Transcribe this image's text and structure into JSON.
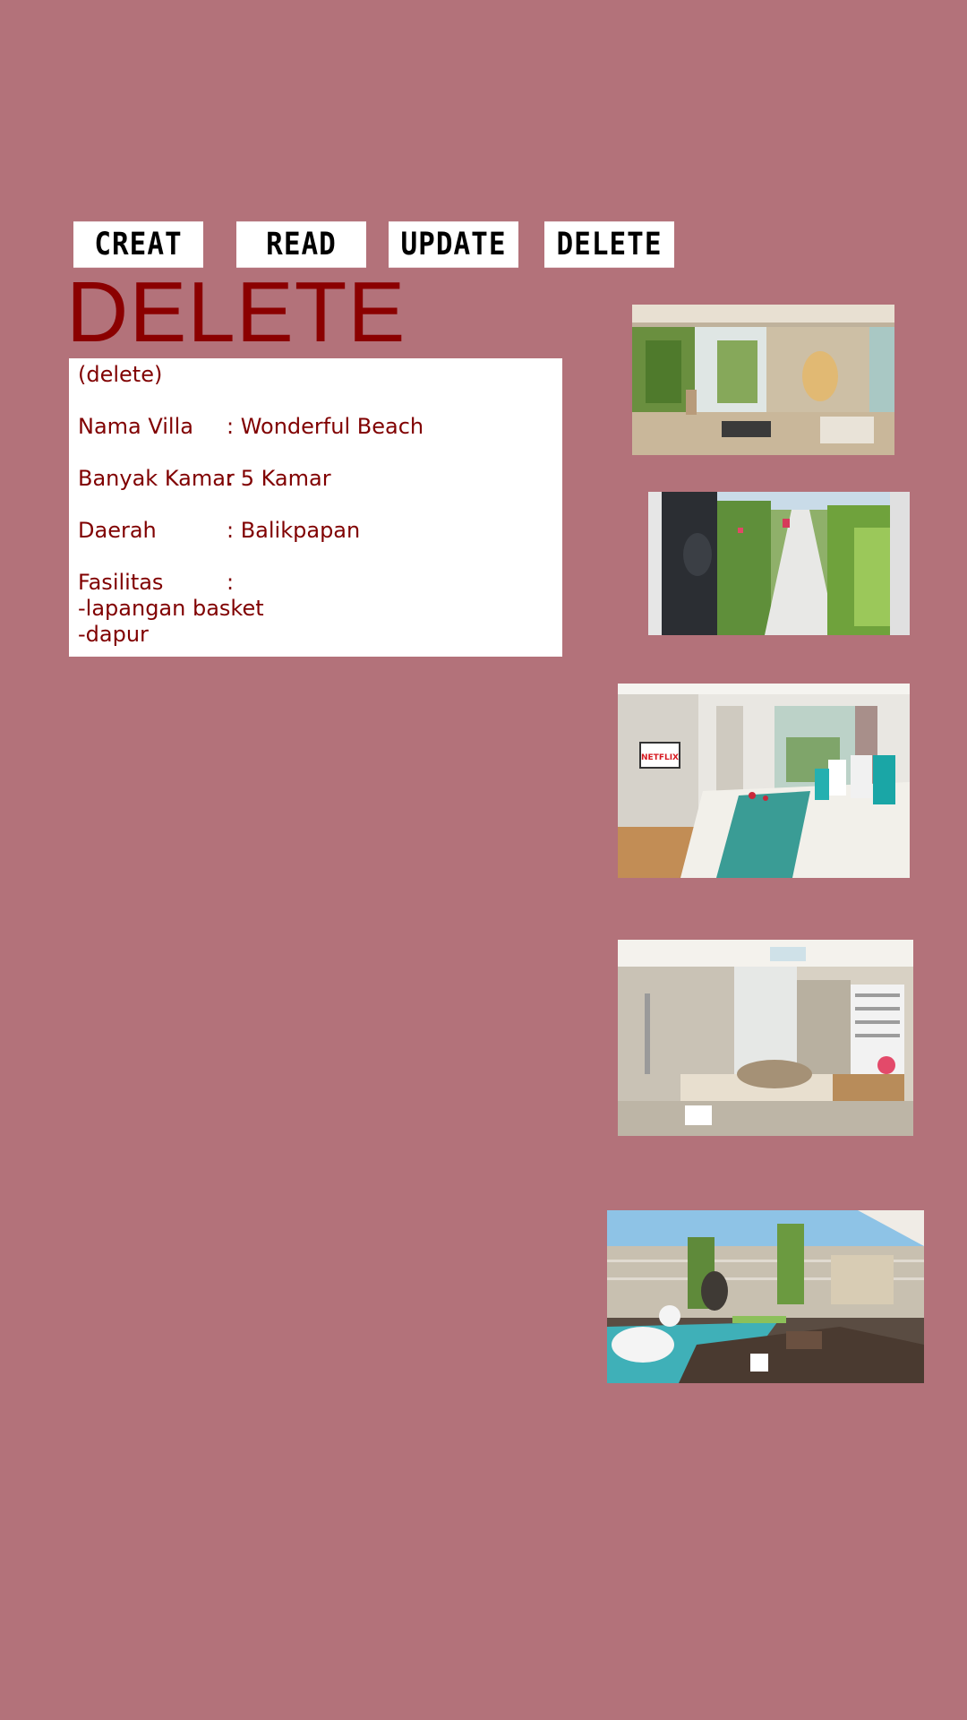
{
  "nav": {
    "create_label": "CREAT",
    "read_label": "READ",
    "update_label": "UPDATE",
    "delete_label": "DELETE"
  },
  "page_title": "DELETE",
  "card": {
    "mode": "(delete)",
    "fields": [
      {
        "label": "Nama Villa",
        "value": ": Wonderful Beach"
      },
      {
        "label": "Banyak Kamar",
        "value": ": 5 Kamar"
      },
      {
        "label": "Daerah",
        "value": ": Balikpapan"
      },
      {
        "label": "Fasilitas",
        "value": ":"
      }
    ],
    "facilities": [
      "-lapangan basket",
      "-dapur"
    ]
  },
  "photos": {
    "bedroom_tv_label": "NETFLIX"
  },
  "colors": {
    "background": "#b3727a",
    "title": "#8b0000",
    "card_text": "#800000",
    "button_bg": "#ffffff"
  }
}
